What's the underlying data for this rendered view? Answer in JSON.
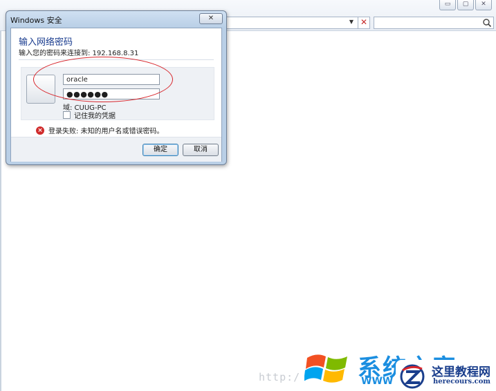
{
  "dialog": {
    "title": "Windows 安全",
    "close_label": "✕",
    "heading": "输入网络密码",
    "subheading": "输入您的密码来连接到: 192.168.8.31",
    "username_value": "oracle",
    "password_value": "●●●●●●",
    "domain_text": "域: CUUG-PC",
    "remember_label": "记住我的凭据",
    "remember_checked": false,
    "error_text": "登录失败: 未知的用户名或错误密码。",
    "ok_label": "确定",
    "cancel_label": "取消"
  },
  "browser": {
    "window_controls": [
      "▭",
      "▢",
      "✕"
    ],
    "stop_icon": "✕",
    "dropdown_icon": "▼"
  },
  "watermark": {
    "url_text": "http:/",
    "brand_cn": "系统之家",
    "brand_www": "WWW",
    "site_cn": "这里教程网",
    "site_en": "herecours.com"
  },
  "colors": {
    "accent": "#1a3c8f",
    "error": "#d02b2b",
    "annotation": "#d8262c"
  }
}
